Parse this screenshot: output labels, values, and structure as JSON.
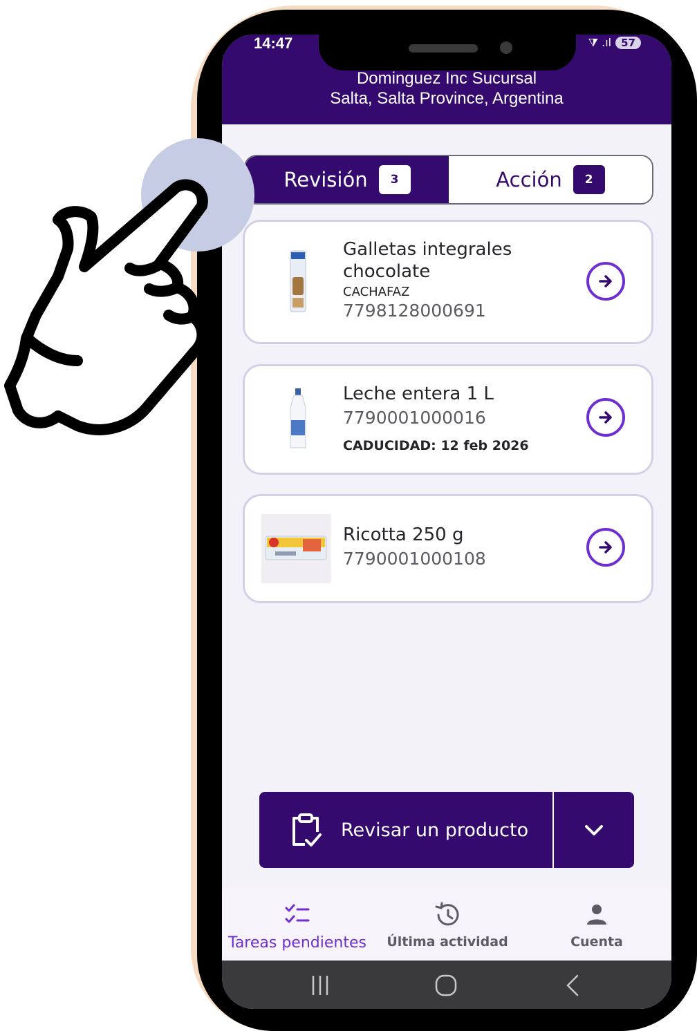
{
  "status_bar": {
    "time": "14:47",
    "signal": "⧩ .ıl",
    "battery": "57"
  },
  "header": {
    "store_name": "Dominguez Inc Sucursal",
    "store_location": "Salta, Salta Province, Argentina"
  },
  "tabs": [
    {
      "label": "Revisión",
      "count": "3",
      "active": true
    },
    {
      "label": "Acción",
      "count": "2",
      "active": false
    }
  ],
  "products": [
    {
      "title_line1": "Galletas integrales",
      "title_line2": "chocolate",
      "brand": "CACHAFAZ",
      "code": "7798128000691"
    },
    {
      "title_line1": "Leche entera 1 L",
      "code": "7790001000016",
      "expiry": "CADUCIDAD: 12 feb 2026"
    },
    {
      "title_line1": "Ricotta 250 g",
      "code": "7790001000108"
    }
  ],
  "cta": {
    "label": "Revisar un producto"
  },
  "bottom_nav": [
    {
      "label": "Tareas pendientes",
      "icon": "checklist-icon",
      "active": true
    },
    {
      "label": "Última actividad",
      "icon": "history-icon",
      "active": false
    },
    {
      "label": "Cuenta",
      "icon": "person-icon",
      "active": false
    }
  ],
  "colors": {
    "primary": "#350a6e",
    "accent": "#6d2fd0",
    "background": "#f3f2f8",
    "frame": "#f7dcc5"
  }
}
